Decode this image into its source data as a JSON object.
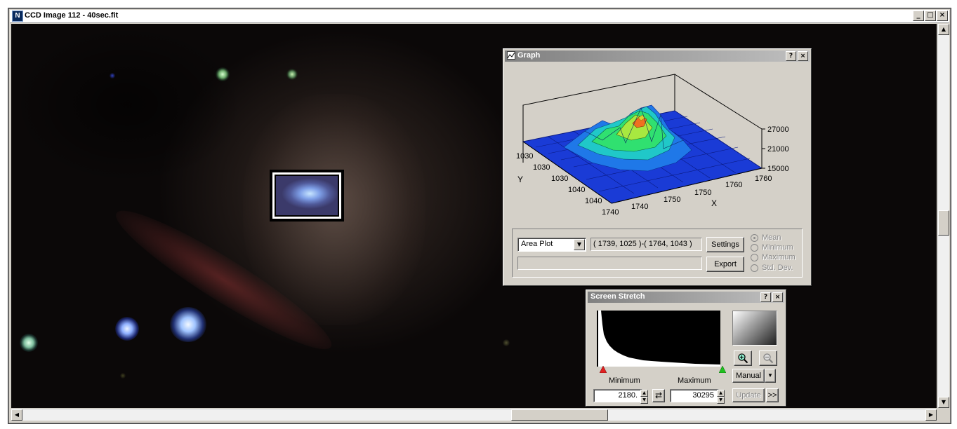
{
  "window": {
    "title": "CCD Image 112 - 40sec.fit",
    "app_icon": "N",
    "controls": {
      "minimize": "_",
      "maximize": "□",
      "close": "×"
    }
  },
  "graph": {
    "title": "Graph",
    "help": "?",
    "close": "×",
    "plot_type": "Area Plot",
    "region": "( 1739, 1025 )-( 1764, 1043 )",
    "settings_label": "Settings",
    "export_label": "Export",
    "status": "",
    "stat_options": [
      "Mean",
      "Minimum",
      "Maximum",
      "Std. Dev."
    ],
    "stat_selected": "Mean",
    "plot": {
      "z_ticks": [
        "27000",
        "21000",
        "15000"
      ],
      "y_label": "Y",
      "y_ticks": [
        "1030",
        "1030",
        "1030",
        "1040",
        "1040"
      ],
      "x_label": "X",
      "x_ticks": [
        "1740",
        "1740",
        "1750",
        "1750",
        "1760",
        "1760"
      ]
    }
  },
  "stretch": {
    "title": "Screen Stretch",
    "help": "?",
    "close": "×",
    "minimum_label": "Minimum",
    "maximum_label": "Maximum",
    "minimum_value": "2180.",
    "maximum_value": "30295",
    "mode": "Manual",
    "update_label": "Update",
    "more_label": ">>",
    "swap_symbol": "⇄"
  },
  "colors": {
    "plot_bg": "#d4d0c8",
    "surface_blue": "#1a3bd6",
    "peak_orange": "#f07020",
    "selection_border": "#ffffff"
  }
}
